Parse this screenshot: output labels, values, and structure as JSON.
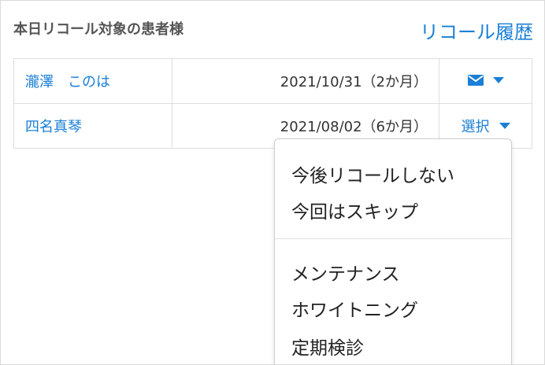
{
  "panel": {
    "title": "本日リコール対象の患者様",
    "history_link": "リコール履歴"
  },
  "rows": [
    {
      "name": "瀧澤　このは",
      "date": "2021/10/31（2か月）",
      "action": "mail-icon",
      "action_label": ""
    },
    {
      "name": "四名真琴",
      "date": "2021/08/02（6か月）",
      "action": "select",
      "action_label": "選択"
    }
  ],
  "dropdown": {
    "group1": [
      "今後リコールしない",
      "今回はスキップ"
    ],
    "group2": [
      "メンテナンス",
      "ホワイトニング",
      "定期検診"
    ]
  },
  "colors": {
    "accent": "#1a7fd6",
    "text": "#333333",
    "title": "#555555",
    "border": "#dedede"
  }
}
